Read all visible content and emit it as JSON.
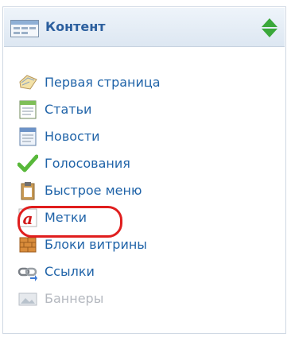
{
  "panel": {
    "title": "Контент",
    "title_icon": "module-window-icon",
    "toggle_icon": "expand-collapse-icon"
  },
  "menu": {
    "items": [
      {
        "label": "Первая страница",
        "icon": "homepage-icon",
        "enabled": true
      },
      {
        "label": "Статьи",
        "icon": "articles-icon",
        "enabled": true
      },
      {
        "label": "Новости",
        "icon": "news-icon",
        "enabled": true
      },
      {
        "label": "Голосования",
        "icon": "checkmark-icon",
        "enabled": true
      },
      {
        "label": "Быстрое меню",
        "icon": "clipboard-icon",
        "enabled": true
      },
      {
        "label": "Метки",
        "icon": "tag-letter-a-icon",
        "enabled": true,
        "highlighted": true
      },
      {
        "label": "Блоки витрины",
        "icon": "brick-blocks-icon",
        "enabled": true
      },
      {
        "label": "Ссылки",
        "icon": "link-chain-icon",
        "enabled": true
      },
      {
        "label": "Баннеры",
        "icon": "banner-image-icon",
        "enabled": false
      }
    ]
  },
  "colors": {
    "link": "#1f63a8",
    "header_title": "#2c5f9e",
    "disabled": "#b4b8bf",
    "highlight": "#e01e1e",
    "toggle_green": "#3aa83a"
  }
}
